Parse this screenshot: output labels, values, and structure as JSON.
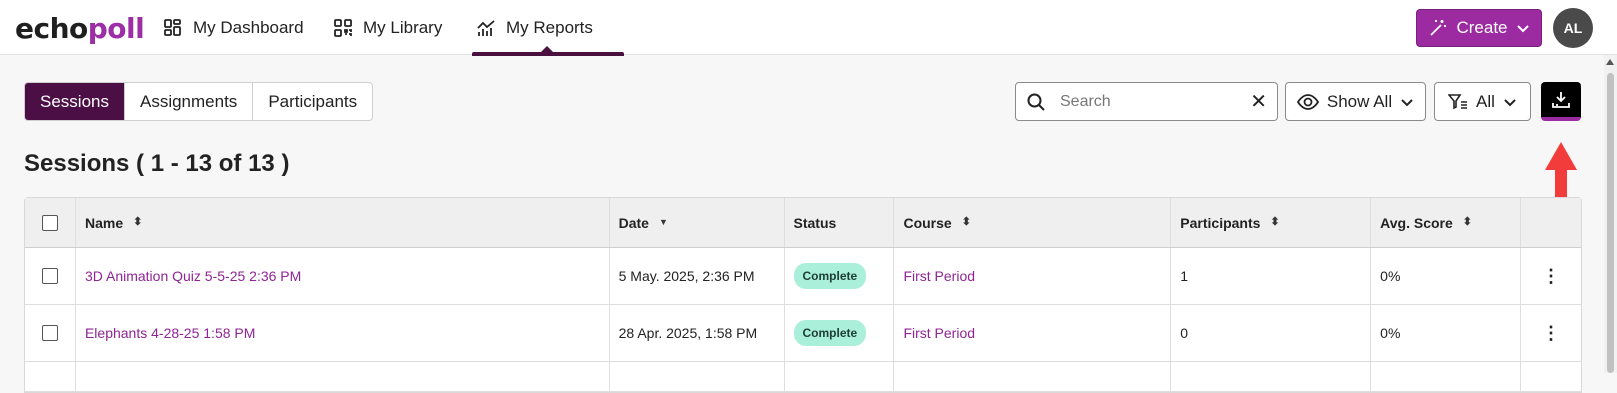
{
  "brand": {
    "echo": "echo",
    "poll": "poll"
  },
  "nav": {
    "items": [
      {
        "label": "My Dashboard",
        "icon": "dashboard-icon"
      },
      {
        "label": "My Library",
        "icon": "library-icon"
      },
      {
        "label": "My Reports",
        "icon": "reports-icon",
        "active": true
      }
    ],
    "create_label": "Create",
    "avatar_initials": "AL"
  },
  "tabs": [
    {
      "label": "Sessions",
      "active": true
    },
    {
      "label": "Assignments"
    },
    {
      "label": "Participants"
    }
  ],
  "toolbar": {
    "search_placeholder": "Search",
    "show_label": "Show All",
    "filter_label": "All"
  },
  "heading": "Sessions ( 1 - 13 of 13 )",
  "table": {
    "columns": {
      "name": "Name",
      "date": "Date",
      "status": "Status",
      "course": "Course",
      "participants": "Participants",
      "score": "Avg. Score"
    },
    "rows": [
      {
        "name": "3D Animation Quiz 5-5-25 2:36 PM",
        "date": "5 May. 2025, 2:36 PM",
        "status": "Complete",
        "course": "First Period",
        "participants": "1",
        "score": "0%"
      },
      {
        "name": "Elephants 4-28-25 1:58 PM",
        "date": "28 Apr. 2025, 1:58 PM",
        "status": "Complete",
        "course": "First Period",
        "participants": "0",
        "score": "0%"
      }
    ]
  },
  "colors": {
    "accent": "#9c2aa0",
    "active_tab": "#4b0f45",
    "badge": "#a9efd9",
    "arrow": "#f23b3b"
  }
}
